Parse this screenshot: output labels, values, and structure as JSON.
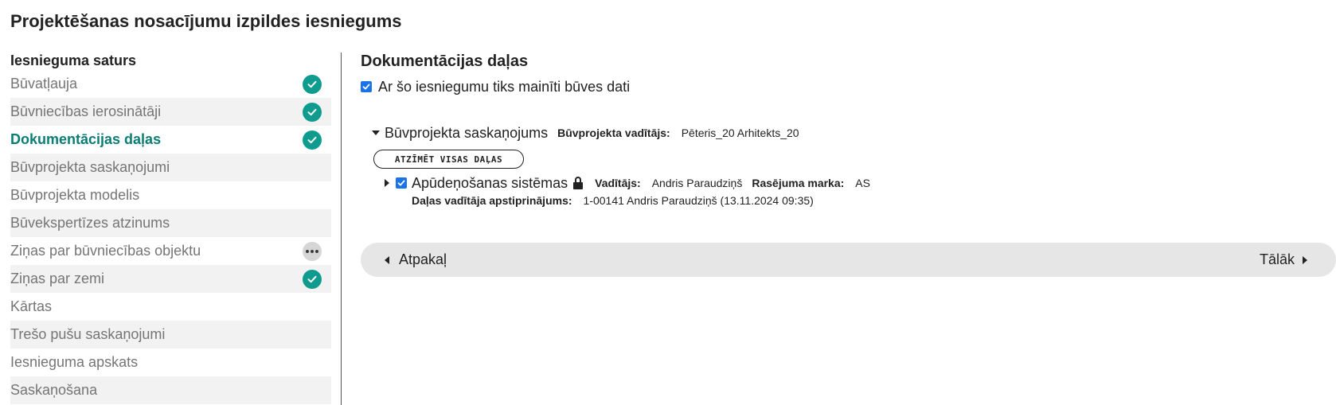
{
  "page": {
    "title": "Projektēšanas nosacījumu izpildes iesniegums"
  },
  "sidebar": {
    "heading": "Iesnieguma saturs",
    "items": [
      {
        "label": "Būvatļauja",
        "status": "done"
      },
      {
        "label": "Būvniecības ierosinātāji",
        "status": "done"
      },
      {
        "label": "Dokumentācijas daļas",
        "status": "done",
        "active": true
      },
      {
        "label": "Būvprojekta saskaņojumi",
        "status": "none"
      },
      {
        "label": "Būvprojekta modelis",
        "status": "none"
      },
      {
        "label": "Būvekspertīzes atzinums",
        "status": "none"
      },
      {
        "label": "Ziņas par būvniecības objektu",
        "status": "pending"
      },
      {
        "label": "Ziņas par zemi",
        "status": "done"
      },
      {
        "label": "Kārtas",
        "status": "none"
      },
      {
        "label": "Trešo pušu saskaņojumi",
        "status": "none"
      },
      {
        "label": "Iesnieguma apskats",
        "status": "none"
      },
      {
        "label": "Saskaņošana",
        "status": "none"
      }
    ]
  },
  "main": {
    "title": "Dokumentācijas daļas",
    "change_data_checkbox": {
      "label": "Ar šo iesniegumu tiks mainīti būves dati",
      "checked": true
    },
    "group": {
      "name": "Būvprojekta saskaņojums",
      "manager_label": "Būvprojekta vadītājs:",
      "manager_value": "Pēteris_20 Arhitekts_20",
      "mark_all_button": "ATZĪMĒT VISAS DAĻAS",
      "part": {
        "name": "Apūdeņošanas sistēmas",
        "checked": true,
        "locked": true,
        "lead_label": "Vadītājs:",
        "lead_value": "Andris Paraudziņš",
        "mark_label": "Rasējuma marka:",
        "mark_value": "AS",
        "approval_label": "Daļas vadītāja apstiprinājums:",
        "approval_value": "1-00141 Andris Paraudziņš (13.11.2024 09:35)"
      }
    }
  },
  "nav": {
    "back_label": "Atpakaļ",
    "next_label": "Tālāk"
  },
  "colors": {
    "accent": "#0a7d75",
    "status_done": "#0f9b8e",
    "checkbox": "#1a73e8",
    "nav_bg": "#e6e6e6",
    "alt_row": "#f2f2f2"
  }
}
